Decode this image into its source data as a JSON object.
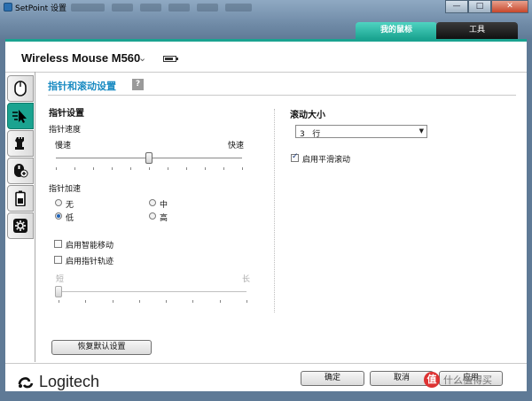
{
  "window": {
    "title": "SetPoint 设置",
    "controls": {
      "minimize": "—",
      "maximize": "□",
      "close": "✕"
    }
  },
  "top_tabs": [
    {
      "label": "我的鼠标",
      "active": true
    },
    {
      "label": "工具",
      "active": false
    }
  ],
  "device": {
    "name": "Wireless Mouse M560",
    "battery_level": 0.85
  },
  "side_tabs": [
    {
      "icon": "mouse-buttons-icon",
      "active": false
    },
    {
      "icon": "pointer-speed-icon",
      "active": true
    },
    {
      "icon": "game-chess-icon",
      "active": false
    },
    {
      "icon": "mouse-plus-icon",
      "active": false
    },
    {
      "icon": "battery-icon",
      "active": false
    },
    {
      "icon": "gear-icon",
      "active": false
    }
  ],
  "section": {
    "title": "指针和滚动设置",
    "help": "?"
  },
  "pointer": {
    "heading": "指针设置",
    "speed_label": "指针速度",
    "slow": "慢速",
    "fast": "快速",
    "speed_value": 0.5,
    "accel_label": "指针加速",
    "accel_options": [
      {
        "label": "无",
        "selected": false
      },
      {
        "label": "中",
        "selected": false
      },
      {
        "label": "低",
        "selected": true
      },
      {
        "label": "高",
        "selected": false
      }
    ],
    "smart_move": {
      "label": "启用智能移动",
      "checked": false
    },
    "trails": {
      "label": "启用指针轨迹",
      "checked": false
    },
    "trail_short": "短",
    "trail_long": "长",
    "trail_value": 0.0
  },
  "scroll": {
    "heading": "滚动大小",
    "size_value": "3   行",
    "smooth": {
      "label": "启用平滑滚动",
      "checked": true
    }
  },
  "buttons": {
    "restore_defaults": "恢复默认设置",
    "ok": "确定",
    "cancel": "取消",
    "apply": "应用"
  },
  "brand": {
    "name": "Logitech"
  },
  "watermark": {
    "badge": "值",
    "text": "什么值得买"
  },
  "colors": {
    "accent": "#1aa390",
    "section_title": "#1a8bc2"
  }
}
